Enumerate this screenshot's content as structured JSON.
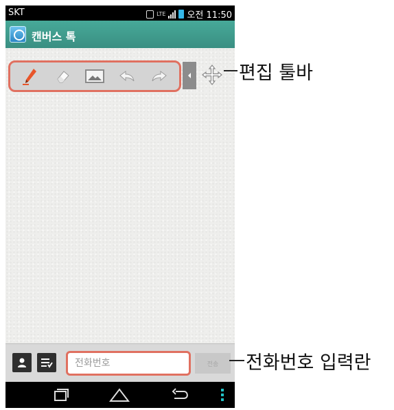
{
  "status_bar": {
    "carrier": "SKT",
    "network": "LTE",
    "time": "오전 11:50"
  },
  "app": {
    "title": "캔버스 톡",
    "icon": "canvas-talk-app-icon"
  },
  "toolbar": {
    "tools": [
      "pen-icon",
      "eraser-icon",
      "image-icon",
      "undo-icon",
      "redo-icon"
    ],
    "collapse": "chevron-left-icon",
    "move": "move-icon"
  },
  "input_bar": {
    "contact_button": "contacts-icon",
    "list_button": "list-icon",
    "phone_placeholder": "전화번호",
    "send_label": "전송"
  },
  "nav_bar": {
    "buttons": [
      "recent-apps-icon",
      "home-icon",
      "back-icon",
      "menu-icon"
    ]
  },
  "callouts": {
    "toolbar_label": "편집 툴바",
    "input_label": "전화번호 입력란"
  },
  "colors": {
    "accent": "#3a8f82",
    "highlight": "#e07060"
  }
}
